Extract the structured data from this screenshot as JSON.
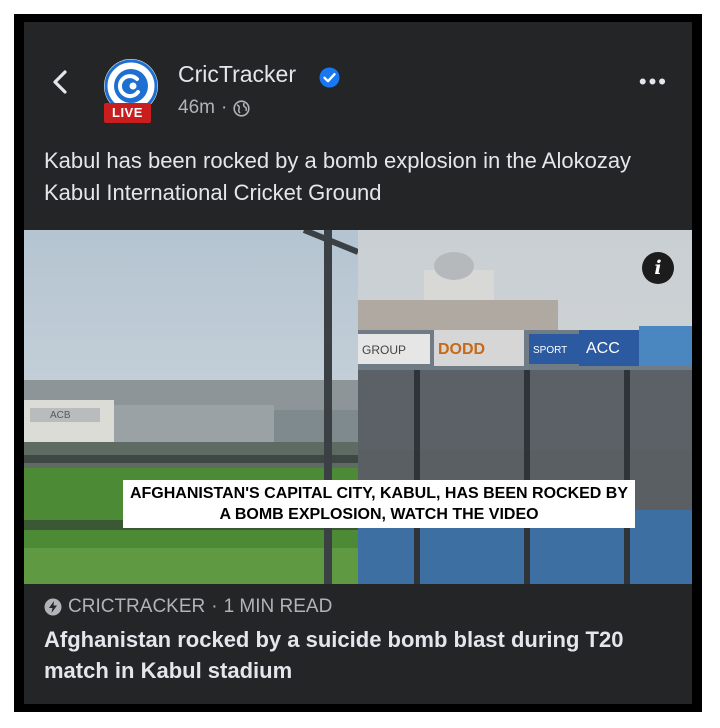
{
  "post": {
    "page_name": "CricTracker",
    "live_badge": "LIVE",
    "time_ago": "46m",
    "separator": "·",
    "text": "Kabul has been rocked by a bomb explosion in the Alokozay Kabul International Cricket Ground"
  },
  "media": {
    "caption": "AFGHANISTAN'S CAPITAL CITY, KABUL, HAS BEEN ROCKED BY A BOMB EXPLOSION, WATCH THE VIDEO",
    "info_symbol": "i",
    "signs": {
      "group": "GROUP",
      "dodd": "DODD",
      "sport": "SPORT",
      "acc": "ACC",
      "acb": "ACB"
    }
  },
  "link": {
    "source": "CRICTRACKER",
    "read_time": "1 MIN READ",
    "separator": "·",
    "title": "Afghanistan rocked by a suicide bomb blast during T20 match in Kabul stadium"
  },
  "icons": {
    "back": "back-arrow-icon",
    "verified": "verified-badge-icon",
    "globe": "globe-icon",
    "more": "more-options-icon",
    "info": "info-icon",
    "source": "lightning-bolt-icon"
  },
  "colors": {
    "card_bg": "#242526",
    "text_primary": "#e4e6eb",
    "text_secondary": "#b0b3b8",
    "verified_blue": "#1877f2",
    "live_red": "#c81e1e"
  }
}
